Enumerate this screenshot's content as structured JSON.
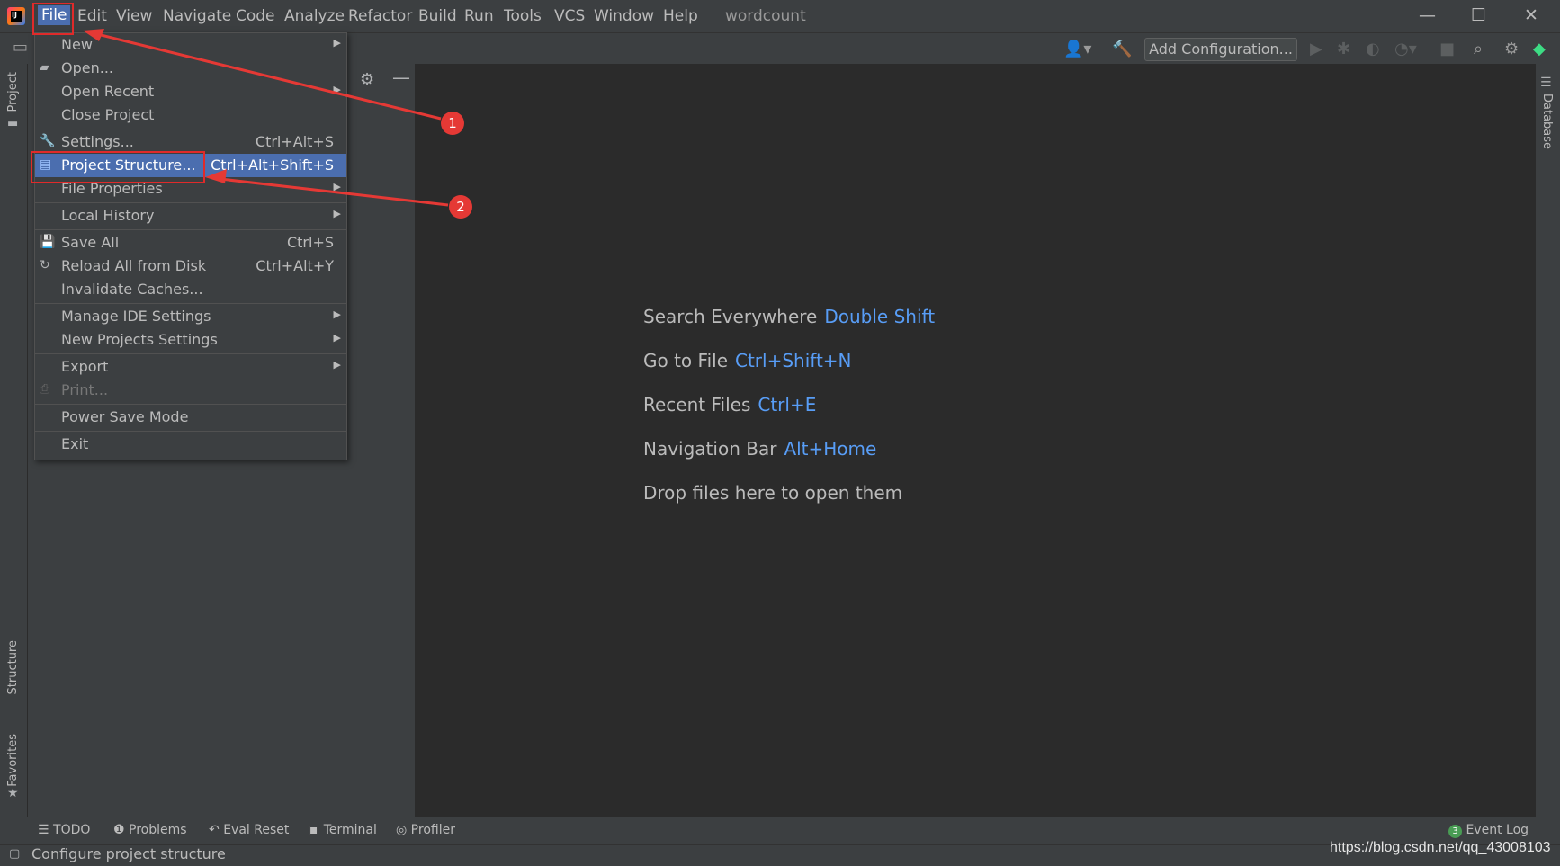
{
  "menubar": {
    "items": [
      "File",
      "Edit",
      "View",
      "Navigate",
      "Code",
      "Analyze",
      "Refactor",
      "Build",
      "Run",
      "Tools",
      "VCS",
      "Window",
      "Help"
    ],
    "window_title": "wordcount",
    "app_icon": "IJ"
  },
  "window_controls": {
    "minimize": "—",
    "maximize": "☐",
    "close": "✕"
  },
  "toolbar": {
    "add_configuration": "Add Configuration..."
  },
  "left_stripe": {
    "project_tab": "Project",
    "structure_tab": "Structure",
    "favorites_tab": "Favorites"
  },
  "right_stripe": {
    "database_tab": "Database"
  },
  "file_menu": {
    "items": [
      {
        "label": "New",
        "shortcut": "",
        "submenu": true,
        "icon": ""
      },
      {
        "label": "Open...",
        "shortcut": "",
        "submenu": false,
        "icon": "folder-open-icon"
      },
      {
        "label": "Open Recent",
        "shortcut": "",
        "submenu": true,
        "icon": ""
      },
      {
        "label": "Close Project",
        "shortcut": "",
        "submenu": false,
        "icon": ""
      },
      {
        "label": "Settings...",
        "shortcut": "Ctrl+Alt+S",
        "submenu": false,
        "icon": "wrench-icon"
      },
      {
        "label": "Project Structure...",
        "shortcut": "Ctrl+Alt+Shift+S",
        "submenu": false,
        "icon": "project-structure-icon"
      },
      {
        "label": "File Properties",
        "shortcut": "",
        "submenu": true,
        "icon": ""
      },
      {
        "label": "Local History",
        "shortcut": "",
        "submenu": true,
        "icon": ""
      },
      {
        "label": "Save All",
        "shortcut": "Ctrl+S",
        "submenu": false,
        "icon": "save-icon"
      },
      {
        "label": "Reload All from Disk",
        "shortcut": "Ctrl+Alt+Y",
        "submenu": false,
        "icon": "reload-icon"
      },
      {
        "label": "Invalidate Caches...",
        "shortcut": "",
        "submenu": false,
        "icon": ""
      },
      {
        "label": "Manage IDE Settings",
        "shortcut": "",
        "submenu": true,
        "icon": ""
      },
      {
        "label": "New Projects Settings",
        "shortcut": "",
        "submenu": true,
        "icon": ""
      },
      {
        "label": "Export",
        "shortcut": "",
        "submenu": true,
        "icon": ""
      },
      {
        "label": "Print...",
        "shortcut": "",
        "submenu": false,
        "icon": "print-icon"
      },
      {
        "label": "Power Save Mode",
        "shortcut": "",
        "submenu": false,
        "icon": ""
      },
      {
        "label": "Exit",
        "shortcut": "",
        "submenu": false,
        "icon": ""
      }
    ]
  },
  "editor_hints": [
    {
      "text": "Search Everywhere",
      "key": "Double Shift"
    },
    {
      "text": "Go to File",
      "key": "Ctrl+Shift+N"
    },
    {
      "text": "Recent Files",
      "key": "Ctrl+E"
    },
    {
      "text": "Navigation Bar",
      "key": "Alt+Home"
    },
    {
      "text": "Drop files here to open them",
      "key": ""
    }
  ],
  "bottom_tabs": [
    "TODO",
    "Problems",
    "Eval Reset",
    "Terminal",
    "Profiler"
  ],
  "event_log": {
    "count": "3",
    "label": "Event Log"
  },
  "status": {
    "text": "Configure project structure"
  },
  "watermark": "https://blog.csdn.net/qq_43008103",
  "annotations": {
    "badge1": "1",
    "badge2": "2"
  },
  "colors": {
    "accent": "#4b6eaf",
    "link": "#589df6",
    "annotation": "#e53935"
  }
}
